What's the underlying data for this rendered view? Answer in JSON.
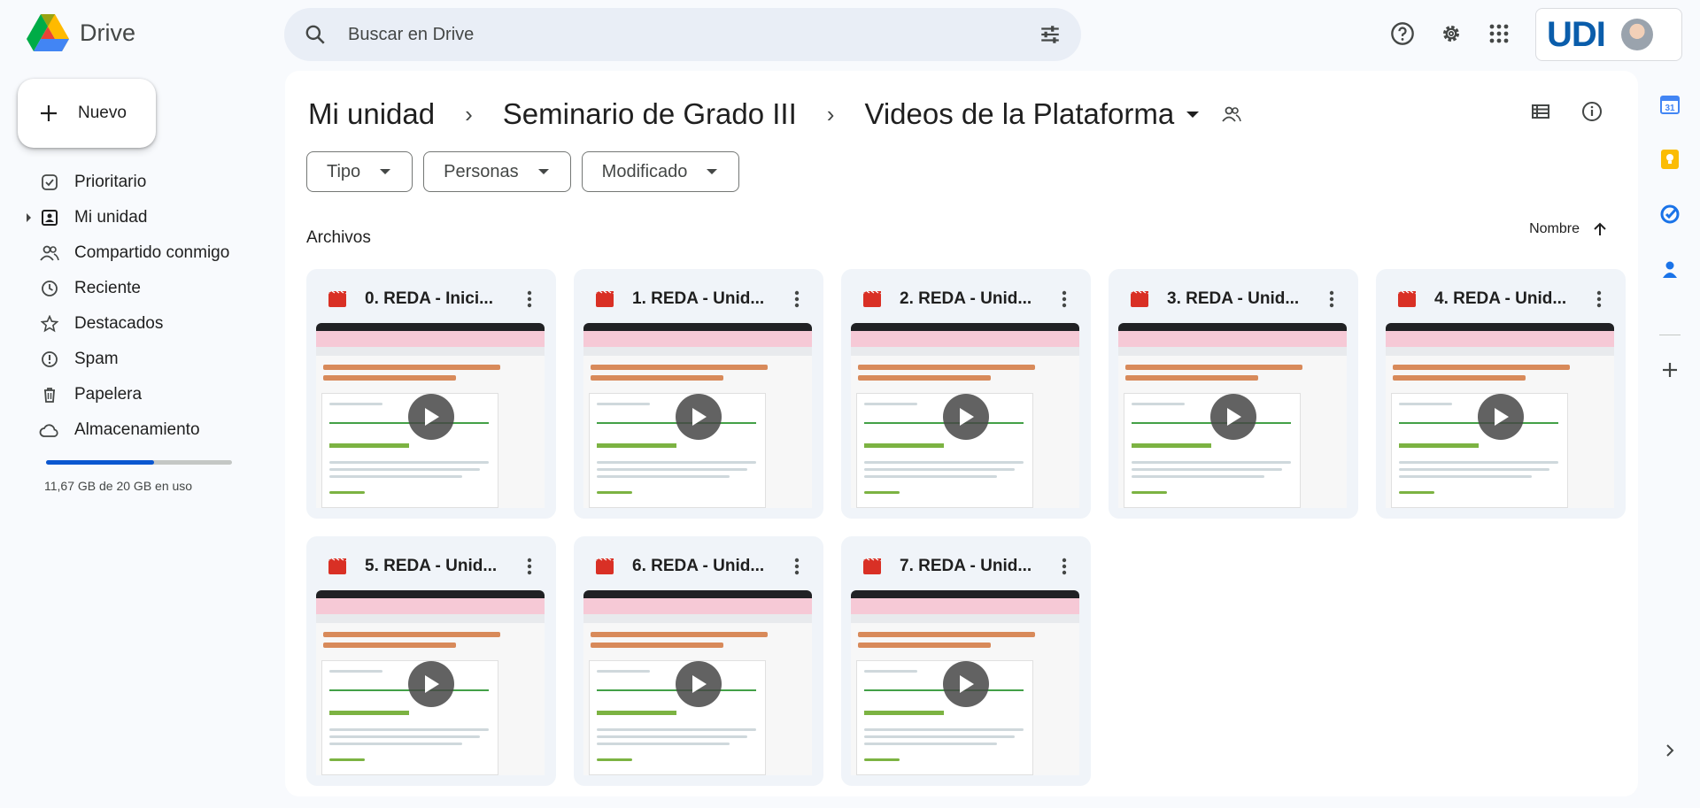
{
  "app": {
    "name": "Drive"
  },
  "search": {
    "placeholder": "Buscar en Drive"
  },
  "header": {
    "account_logo_text": "UDI"
  },
  "sidebar": {
    "new_label": "Nuevo",
    "items": [
      {
        "label": "Prioritario",
        "icon": "priority-icon"
      },
      {
        "label": "Mi unidad",
        "icon": "my-drive-icon"
      },
      {
        "label": "Compartido conmigo",
        "icon": "shared-icon"
      },
      {
        "label": "Reciente",
        "icon": "clock-icon"
      },
      {
        "label": "Destacados",
        "icon": "star-icon"
      },
      {
        "label": "Spam",
        "icon": "spam-icon"
      },
      {
        "label": "Papelera",
        "icon": "trash-icon"
      },
      {
        "label": "Almacenamiento",
        "icon": "cloud-icon"
      }
    ],
    "storage": {
      "text": "11,67 GB de 20 GB en uso",
      "used_fraction": 0.58
    }
  },
  "breadcrumb": {
    "items": [
      "Mi unidad",
      "Seminario de Grado III",
      "Videos de la Plataforma"
    ]
  },
  "filters": [
    "Tipo",
    "Personas",
    "Modificado"
  ],
  "section": {
    "title": "Archivos",
    "sort_label": "Nombre"
  },
  "files": [
    {
      "name": "0. REDA - Inici..."
    },
    {
      "name": "1. REDA - Unid..."
    },
    {
      "name": "2. REDA - Unid..."
    },
    {
      "name": "3. REDA - Unid..."
    },
    {
      "name": "4. REDA - Unid..."
    },
    {
      "name": "5. REDA - Unid..."
    },
    {
      "name": "6. REDA - Unid..."
    },
    {
      "name": "7. REDA - Unid..."
    }
  ],
  "colors": {
    "accent": "#0b57d0",
    "video_icon": "#d93025",
    "panel": "#f0f4f9"
  }
}
